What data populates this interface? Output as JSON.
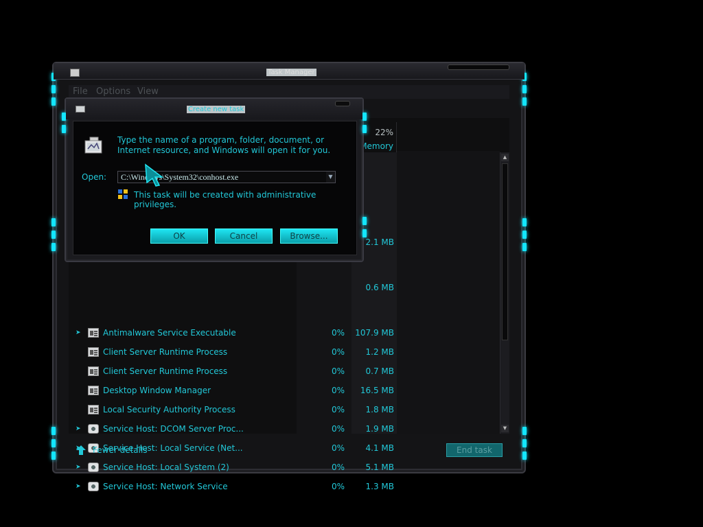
{
  "task_manager": {
    "title": "Task Manager",
    "menu": [
      "File",
      "Options",
      "View"
    ],
    "memory_header": {
      "percent": "22%",
      "label": "Memory"
    },
    "partial_memory_values": [
      "2.1 MB",
      "0.6 MB"
    ],
    "processes": [
      {
        "name": "Antimalware Service Executable",
        "cpu": "0%",
        "memory": "107.9 MB",
        "expandable": true,
        "icon": "window-icon"
      },
      {
        "name": "Client Server Runtime Process",
        "cpu": "0%",
        "memory": "1.2 MB",
        "expandable": false,
        "icon": "window-icon"
      },
      {
        "name": "Client Server Runtime Process",
        "cpu": "0%",
        "memory": "0.7 MB",
        "expandable": false,
        "icon": "window-icon"
      },
      {
        "name": "Desktop Window Manager",
        "cpu": "0%",
        "memory": "16.5 MB",
        "expandable": false,
        "icon": "window-icon"
      },
      {
        "name": "Local Security Authority Process",
        "cpu": "0%",
        "memory": "1.8 MB",
        "expandable": false,
        "icon": "window-icon"
      },
      {
        "name": "Service Host: DCOM Server Proc...",
        "cpu": "0%",
        "memory": "1.9 MB",
        "expandable": true,
        "icon": "gear-icon"
      },
      {
        "name": "Service Host: Local Service (Net...",
        "cpu": "0%",
        "memory": "4.1 MB",
        "expandable": true,
        "icon": "gear-icon"
      },
      {
        "name": "Service Host: Local System (2)",
        "cpu": "0%",
        "memory": "5.1 MB",
        "expandable": true,
        "icon": "gear-icon"
      },
      {
        "name": "Service Host: Network Service",
        "cpu": "0%",
        "memory": "1.3 MB",
        "expandable": true,
        "icon": "gear-icon"
      }
    ],
    "footer": {
      "fewer_details": "Fewer details",
      "end_task": "End task"
    }
  },
  "dialog": {
    "title": "Create new task",
    "description": "Type the name of a program, folder, document, or Internet resource, and Windows will open it for you.",
    "open_label": "Open:",
    "open_value": "C:\\Windows\\System32\\conhost.exe",
    "admin_note": "This task will be created with administrative privileges.",
    "buttons": {
      "ok": "OK",
      "cancel": "Cancel",
      "browse": "Browse..."
    }
  },
  "colors": {
    "accent": "#22c8d8",
    "frame_light": "#13e6ff",
    "background": "#000000"
  }
}
